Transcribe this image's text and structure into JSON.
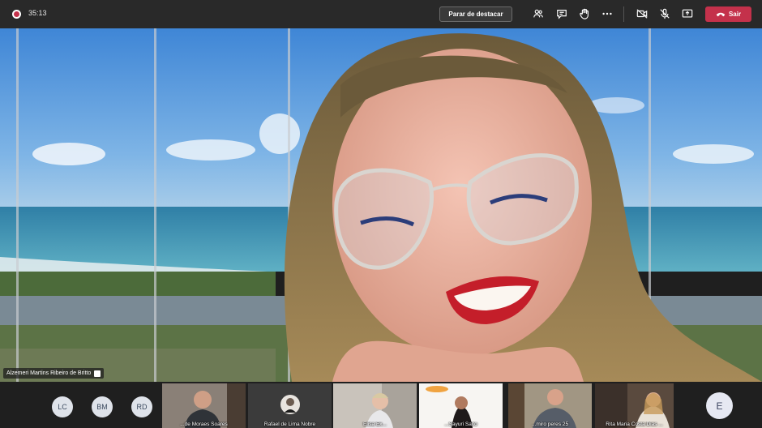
{
  "call": {
    "timer": "35:13",
    "unspotlight_label": "Parar de destacar",
    "leave_label": "Sair",
    "spotlight_name": "Alzemeri Martins Ribeiro de Britto"
  },
  "toolbar_icons": [
    "participants-icon",
    "chat-icon",
    "raise-hand-icon",
    "more-icon",
    "camera-off-icon",
    "mic-off-icon",
    "share-icon"
  ],
  "participants": {
    "avatars": [
      {
        "initials": "LC"
      },
      {
        "initials": "BM"
      },
      {
        "initials": "RD"
      }
    ],
    "tiles": [
      {
        "name": "...de Moraes Soares"
      },
      {
        "name": "Rafael de Lima Nobre"
      },
      {
        "name": "Elisa Ex..."
      },
      {
        "name": "...Sayuri Saito"
      },
      {
        "name": "...miro peres 25"
      },
      {
        "name": "Rita Maria Costa Dias ..."
      }
    ],
    "overflow_avatar": {
      "initials": "E"
    }
  }
}
